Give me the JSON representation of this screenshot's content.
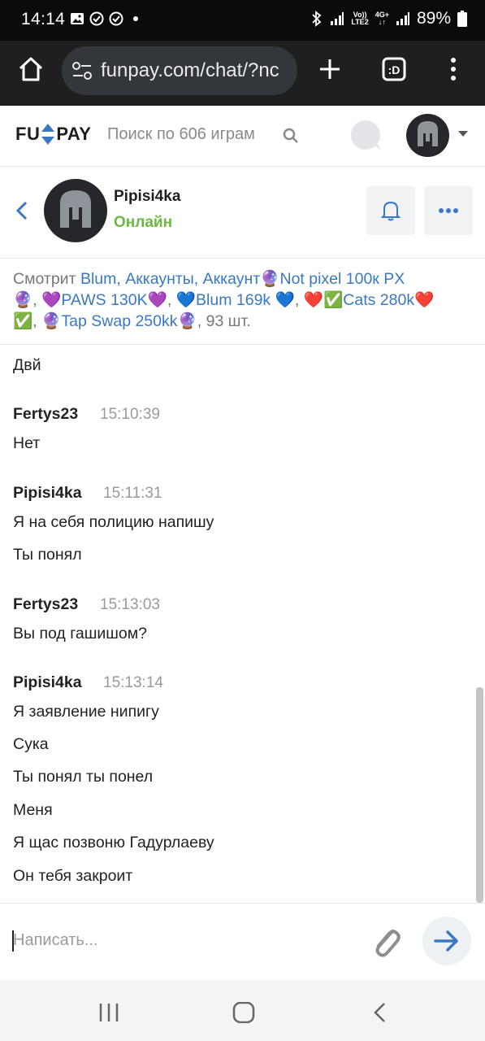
{
  "status_bar": {
    "time": "14:14",
    "network_top": "Vo))",
    "network_bottom": "LTE2",
    "data_top": "4G+",
    "battery": "89%"
  },
  "browser": {
    "url": "funpay.com/chat/?nc"
  },
  "site_header": {
    "logo_left": "FU",
    "logo_right": "PAY",
    "search_placeholder": "Поиск по 606 играм"
  },
  "chat_header": {
    "username": "Pipisi4ka",
    "status": "Онлайн"
  },
  "viewing": {
    "prefix": "Смотрит ",
    "items": [
      {
        "text": "Blum, Аккаунты, Аккаунт",
        "emoji": "🔮"
      },
      {
        "text": "Not pixel 100к PX",
        "emoji": ""
      },
      {
        "text": "🔮, 💜",
        "emoji": ""
      },
      {
        "text": "PAWS 130K",
        "emoji": "💜"
      },
      {
        "text": ", 💙",
        "emoji": ""
      },
      {
        "text": "Blum 169k ",
        "emoji": "💙"
      },
      {
        "text": ", ❤️✅",
        "emoji": ""
      },
      {
        "text": "Cats 280k",
        "emoji": "❤️"
      },
      {
        "text": "✅, 🔮",
        "emoji": ""
      },
      {
        "text": "Tap Swap 250kk",
        "emoji": "🔮"
      }
    ],
    "suffix": ", 93 шт."
  },
  "messages": {
    "m0_text": "Двй",
    "g1_author": "Fertys23",
    "g1_time": "15:10:39",
    "g1_m1": "Нет",
    "g2_author": "Pipisi4ka",
    "g2_time": "15:11:31",
    "g2_m1": "Я на себя полицию напишу",
    "g2_m2": "Ты понял",
    "g3_author": "Fertys23",
    "g3_time": "15:13:03",
    "g3_m1": "Вы под гашишом?",
    "g4_author": "Pipisi4ka",
    "g4_time": "15:13:14",
    "g4_m1": "Я заявление нипигу",
    "g4_m2": "Сука",
    "g4_m3": "Ты понял ты понел",
    "g4_m4": "Меня",
    "g4_m5": "Я щас позвоню Гадурлаеву",
    "g4_m6": "Он тебя закроит"
  },
  "input": {
    "placeholder": "Написать..."
  },
  "colors": {
    "link": "#3a78c2",
    "online": "#6cb843",
    "send_arrow": "#3a78c2"
  }
}
